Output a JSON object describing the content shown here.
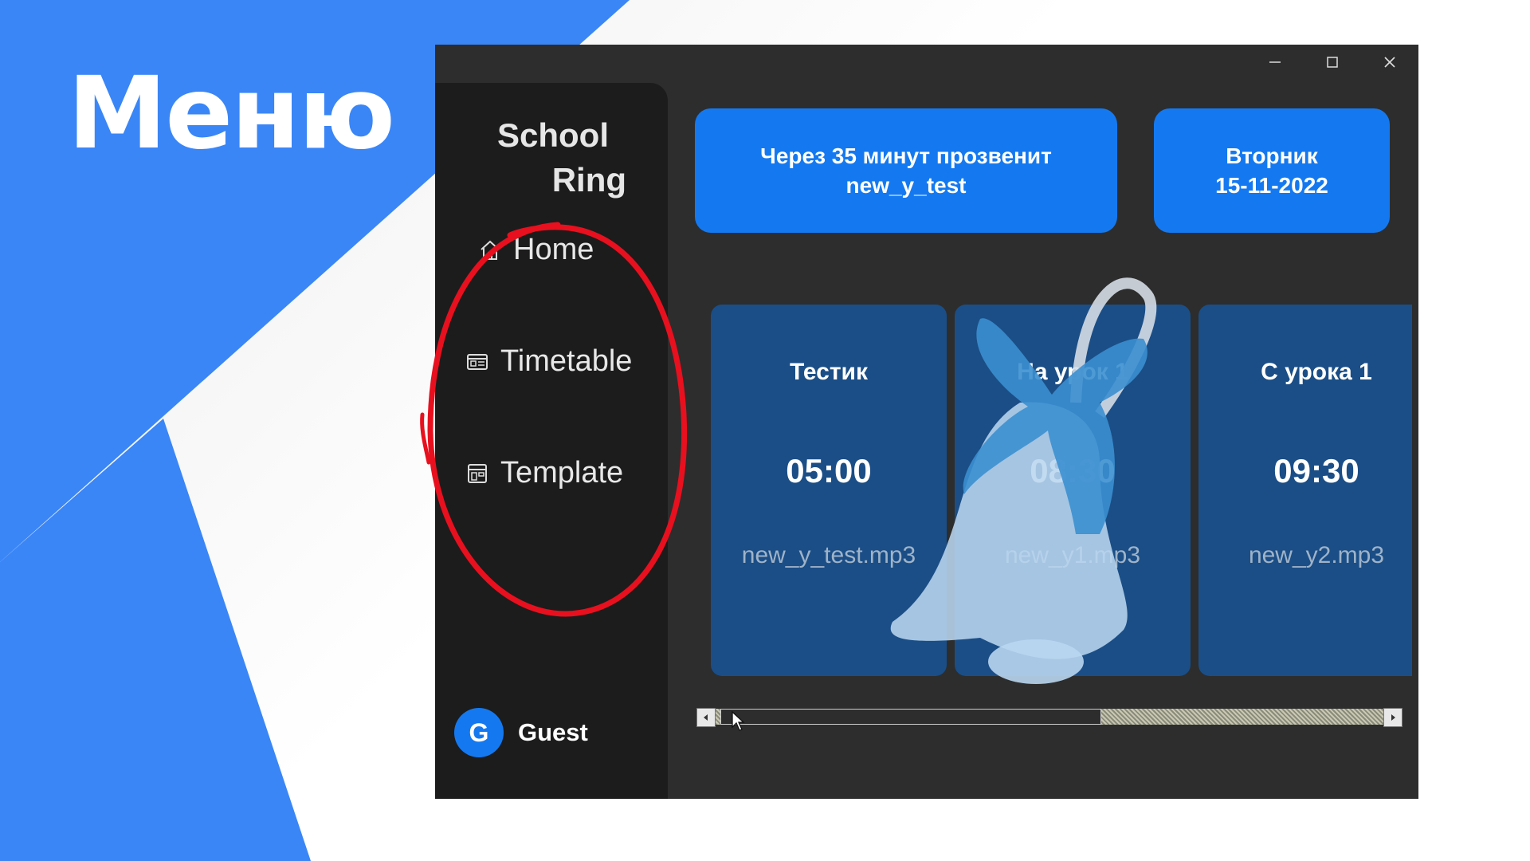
{
  "slide": {
    "headline": "Меню"
  },
  "colors": {
    "brand_blue": "#3a86f7",
    "card_blue": "#1b4e86",
    "banner_blue": "#1479f0",
    "annotation_red": "#e8101e"
  },
  "window": {
    "controls": [
      "minimize-icon",
      "maximize-icon",
      "close-icon"
    ],
    "logo": {
      "line1": "School",
      "line2": "Ring"
    },
    "nav": [
      {
        "label": "Home",
        "icon": "home-icon"
      },
      {
        "label": "Timetable",
        "icon": "timetable-icon"
      },
      {
        "label": "Template",
        "icon": "template-icon"
      }
    ],
    "user": {
      "initial": "G",
      "name": "Guest"
    },
    "banner_next": {
      "line1": "Через 35 минут прозвенит",
      "line2": "new_y_test"
    },
    "banner_date": {
      "weekday": "Вторник",
      "date": "15-11-2022"
    },
    "cards": [
      {
        "name": "Тестик",
        "time": "05:00",
        "file": "new_y_test.mp3"
      },
      {
        "name": "На урок 1",
        "time": "08:30",
        "file": "new_y1.mp3"
      },
      {
        "name": "С урока 1",
        "time": "09:30",
        "file": "new_y2.mp3"
      }
    ]
  }
}
